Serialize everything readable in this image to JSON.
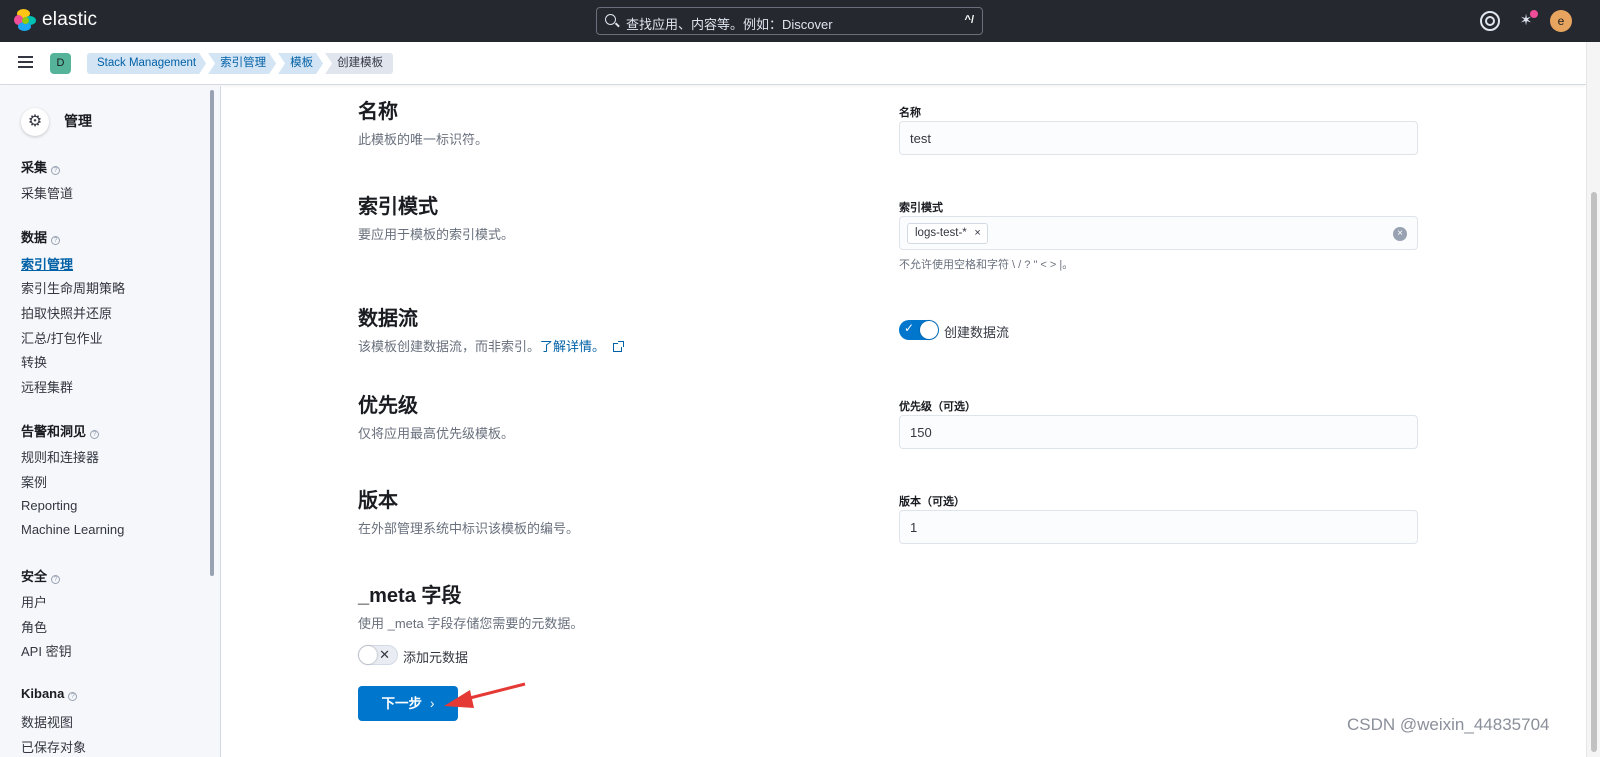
{
  "header": {
    "logo_text": "elastic",
    "search_placeholder": "查找应用、内容等。例如：Discover",
    "search_shortcut": "^/",
    "user_initial": "e",
    "icons": [
      "help-icon",
      "newsfeed-icon"
    ]
  },
  "subbar": {
    "space_initial": "D",
    "breadcrumbs": [
      "Stack Management",
      "索引管理",
      "模板",
      "创建模板"
    ]
  },
  "sidebar": {
    "title": "管理",
    "groups": [
      {
        "label": "采集",
        "items": [
          "采集管道"
        ]
      },
      {
        "label": "数据",
        "items": [
          "索引管理",
          "索引生命周期策略",
          "拍取快照并还原",
          "汇总/打包作业",
          "转换",
          "远程集群"
        ]
      },
      {
        "label": "告警和洞见",
        "items": [
          "规则和连接器",
          "案例",
          "Reporting",
          "Machine Learning"
        ]
      },
      {
        "label": "安全",
        "items": [
          "用户",
          "角色",
          "API 密钥"
        ]
      },
      {
        "label": "Kibana",
        "items": [
          "数据视图",
          "已保存对象"
        ]
      }
    ],
    "active_item": "索引管理"
  },
  "form": {
    "name": {
      "title": "名称",
      "desc": "此模板的唯一标识符。",
      "label": "名称",
      "value": "test"
    },
    "index_patterns": {
      "title": "索引模式",
      "desc": "要应用于模板的索引模式。",
      "label": "索引模式",
      "chip": "logs-test-*",
      "help": "不允许使用空格和字符 \\ / ? \" < > |。"
    },
    "data_stream": {
      "title": "数据流",
      "desc": "该模板创建数据流，而非索引。",
      "link": "了解详情。",
      "toggle_label": "创建数据流",
      "enabled": true
    },
    "priority": {
      "title": "优先级",
      "desc": "仅将应用最高优先级模板。",
      "label": "优先级（可选）",
      "value": "150"
    },
    "version": {
      "title": "版本",
      "desc": "在外部管理系统中标识该模板的编号。",
      "label": "版本（可选）",
      "value": "1"
    },
    "meta": {
      "title": "_meta 字段",
      "desc": "使用 _meta 字段存储您需要的元数据。",
      "toggle_label": "添加元数据",
      "enabled": false
    }
  },
  "actions": {
    "next_label": "下一步"
  },
  "watermark": "CSDN @weixin_44835704",
  "colors": {
    "primary": "#0077cc",
    "header_bg": "#25282f",
    "link": "#0061a6"
  }
}
